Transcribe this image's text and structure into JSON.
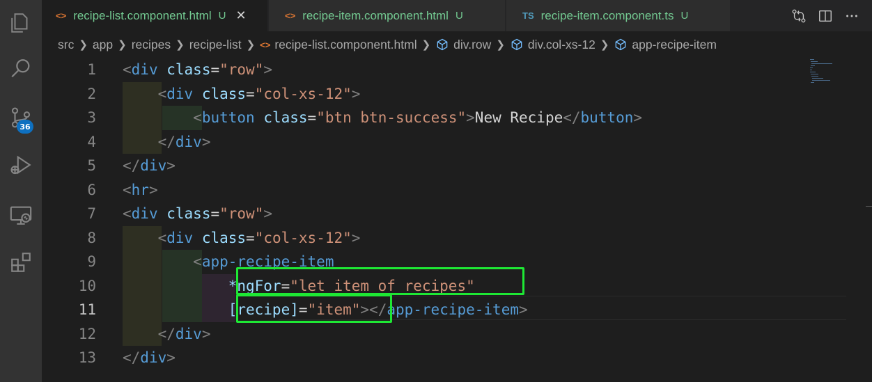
{
  "activity_bar": {
    "icons": [
      "explorer-icon",
      "search-icon",
      "source-control-icon",
      "run-debug-icon",
      "remote-explorer-icon",
      "extensions-icon"
    ],
    "scm_badge": "36"
  },
  "tabs": [
    {
      "icon_glyph": "<>",
      "label": "recipe-list.component.html",
      "flag": "U",
      "active": true,
      "icon_color": "#e37933"
    },
    {
      "icon_glyph": "<>",
      "label": "recipe-item.component.html",
      "flag": "U",
      "active": false,
      "icon_color": "#e37933"
    },
    {
      "icon_glyph": "TS",
      "label": "recipe-item.component.ts",
      "flag": "U",
      "active": false,
      "icon_color": "#519aba"
    }
  ],
  "tab_close": "✕",
  "tab_actions": [
    "open-changes-icon",
    "split-editor-icon",
    "more-actions-icon"
  ],
  "breadcrumb": [
    {
      "label": "src",
      "icon": ""
    },
    {
      "label": "app",
      "icon": ""
    },
    {
      "label": "recipes",
      "icon": ""
    },
    {
      "label": "recipe-list",
      "icon": ""
    },
    {
      "label": "recipe-list.component.html",
      "icon": "html-file-icon"
    },
    {
      "label": "div.row",
      "icon": "element-icon"
    },
    {
      "label": "div.col-xs-12",
      "icon": "element-icon"
    },
    {
      "label": "app-recipe-item",
      "icon": "element-icon"
    }
  ],
  "editor": {
    "current_line": 11,
    "line_numbers": [
      "1",
      "2",
      "3",
      "4",
      "5",
      "6",
      "7",
      "8",
      "9",
      "10",
      "11",
      "12",
      "13"
    ],
    "lines": [
      [
        [
          "punc",
          "<"
        ],
        [
          "tag",
          "div"
        ],
        [
          "plain",
          " "
        ],
        [
          "attr",
          "class"
        ],
        [
          "plain",
          "="
        ],
        [
          "str",
          "\"row\""
        ],
        [
          "punc",
          ">"
        ]
      ],
      [
        [
          "plain",
          "    "
        ],
        [
          "punc",
          "<"
        ],
        [
          "tag",
          "div"
        ],
        [
          "plain",
          " "
        ],
        [
          "attr",
          "class"
        ],
        [
          "plain",
          "="
        ],
        [
          "str",
          "\"col-xs-12\""
        ],
        [
          "punc",
          ">"
        ]
      ],
      [
        [
          "plain",
          "        "
        ],
        [
          "punc",
          "<"
        ],
        [
          "tag",
          "button"
        ],
        [
          "plain",
          " "
        ],
        [
          "attr",
          "class"
        ],
        [
          "plain",
          "="
        ],
        [
          "str",
          "\"btn btn-success\""
        ],
        [
          "punc",
          ">"
        ],
        [
          "plain",
          "New Recipe"
        ],
        [
          "punc",
          "</"
        ],
        [
          "tag",
          "button"
        ],
        [
          "punc",
          ">"
        ]
      ],
      [
        [
          "plain",
          "    "
        ],
        [
          "punc",
          "</"
        ],
        [
          "tag",
          "div"
        ],
        [
          "punc",
          ">"
        ]
      ],
      [
        [
          "punc",
          "</"
        ],
        [
          "tag",
          "div"
        ],
        [
          "punc",
          ">"
        ]
      ],
      [
        [
          "punc",
          "<"
        ],
        [
          "tag",
          "hr"
        ],
        [
          "punc",
          ">"
        ]
      ],
      [
        [
          "punc",
          "<"
        ],
        [
          "tag",
          "div"
        ],
        [
          "plain",
          " "
        ],
        [
          "attr",
          "class"
        ],
        [
          "plain",
          "="
        ],
        [
          "str",
          "\"row\""
        ],
        [
          "punc",
          ">"
        ]
      ],
      [
        [
          "plain",
          "    "
        ],
        [
          "punc",
          "<"
        ],
        [
          "tag",
          "div"
        ],
        [
          "plain",
          " "
        ],
        [
          "attr",
          "class"
        ],
        [
          "plain",
          "="
        ],
        [
          "str",
          "\"col-xs-12\""
        ],
        [
          "punc",
          ">"
        ]
      ],
      [
        [
          "plain",
          "        "
        ],
        [
          "punc",
          "<"
        ],
        [
          "tag",
          "app-recipe-item"
        ]
      ],
      [
        [
          "plain",
          "            "
        ],
        [
          "attr",
          "*ngFor"
        ],
        [
          "plain",
          "="
        ],
        [
          "str",
          "\"let item of recipes\""
        ]
      ],
      [
        [
          "plain",
          "            "
        ],
        [
          "attr",
          "[recipe]"
        ],
        [
          "plain",
          "="
        ],
        [
          "str",
          "\"item\""
        ],
        [
          "punc",
          ">"
        ],
        [
          "punc",
          "</"
        ],
        [
          "tag",
          "app-recipe-item"
        ],
        [
          "punc",
          ">"
        ]
      ],
      [
        [
          "plain",
          "    "
        ],
        [
          "punc",
          "</"
        ],
        [
          "tag",
          "div"
        ],
        [
          "punc",
          ">"
        ]
      ],
      [
        [
          "punc",
          "</"
        ],
        [
          "tag",
          "div"
        ],
        [
          "punc",
          ">"
        ]
      ]
    ]
  },
  "colors": {
    "highlight_box": "#1ee834",
    "tab_modified_text": "#73c991",
    "badge_bg": "#0e70c0"
  }
}
